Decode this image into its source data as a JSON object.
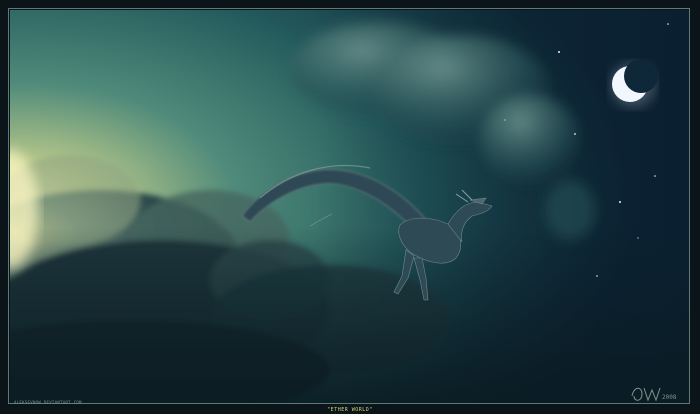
{
  "artwork": {
    "caption": "\"ETHER WORLD\"",
    "credit": "ALEKSEVNOW.DEVIANTART.COM",
    "signature_year": "2008"
  },
  "colors": {
    "frame": "#0b1519",
    "border": "#5e7a78",
    "sky_glow": "#e7e7a0",
    "sky_teal": "#2f6f6a",
    "sky_night": "#0f2a3a",
    "cloud_dark": "#1d3940",
    "moon": "#f2f6ff",
    "caption_text": "#c9d97a"
  }
}
